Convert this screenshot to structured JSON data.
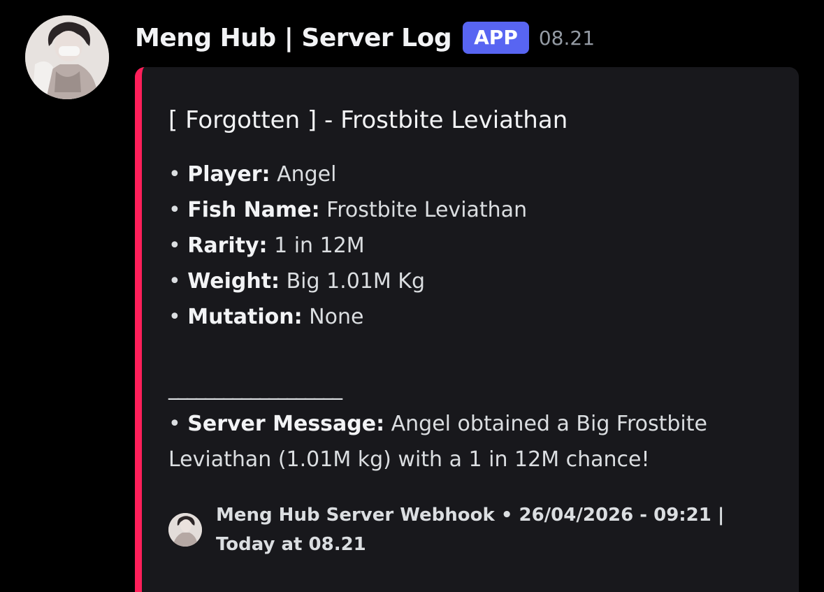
{
  "header": {
    "username": "Meng Hub | Server Log",
    "badge": "APP",
    "time": "08.21"
  },
  "embed": {
    "accent_color": "#ff1f5a",
    "title": "[ Forgotten ] - Frostbite Leviathan",
    "fields": [
      {
        "key": "Player:",
        "value": " Angel"
      },
      {
        "key": "Fish Name:",
        "value": " Frostbite Leviathan"
      },
      {
        "key": "Rarity:",
        "value": " 1 in 12M"
      },
      {
        "key": "Weight:",
        "value": " Big 1.01M Kg"
      },
      {
        "key": "Mutation:",
        "value": " None"
      }
    ],
    "bullet": "• ",
    "divider": "___________________",
    "server_message": {
      "key": "Server Message:",
      "value": " Angel obtained a Big Frostbite Leviathan (1.01M kg) with a 1 in 12M chance!"
    },
    "footer": {
      "text": "Meng Hub Server Webhook • 26/04/2026 - 09:21 | Today at 08.21"
    }
  },
  "icons": {
    "avatar": "user-avatar-icon",
    "footer_avatar": "webhook-avatar-icon"
  },
  "colors": {
    "background": "#000000",
    "embed_background": "#18181c",
    "badge": "#5865f2"
  }
}
